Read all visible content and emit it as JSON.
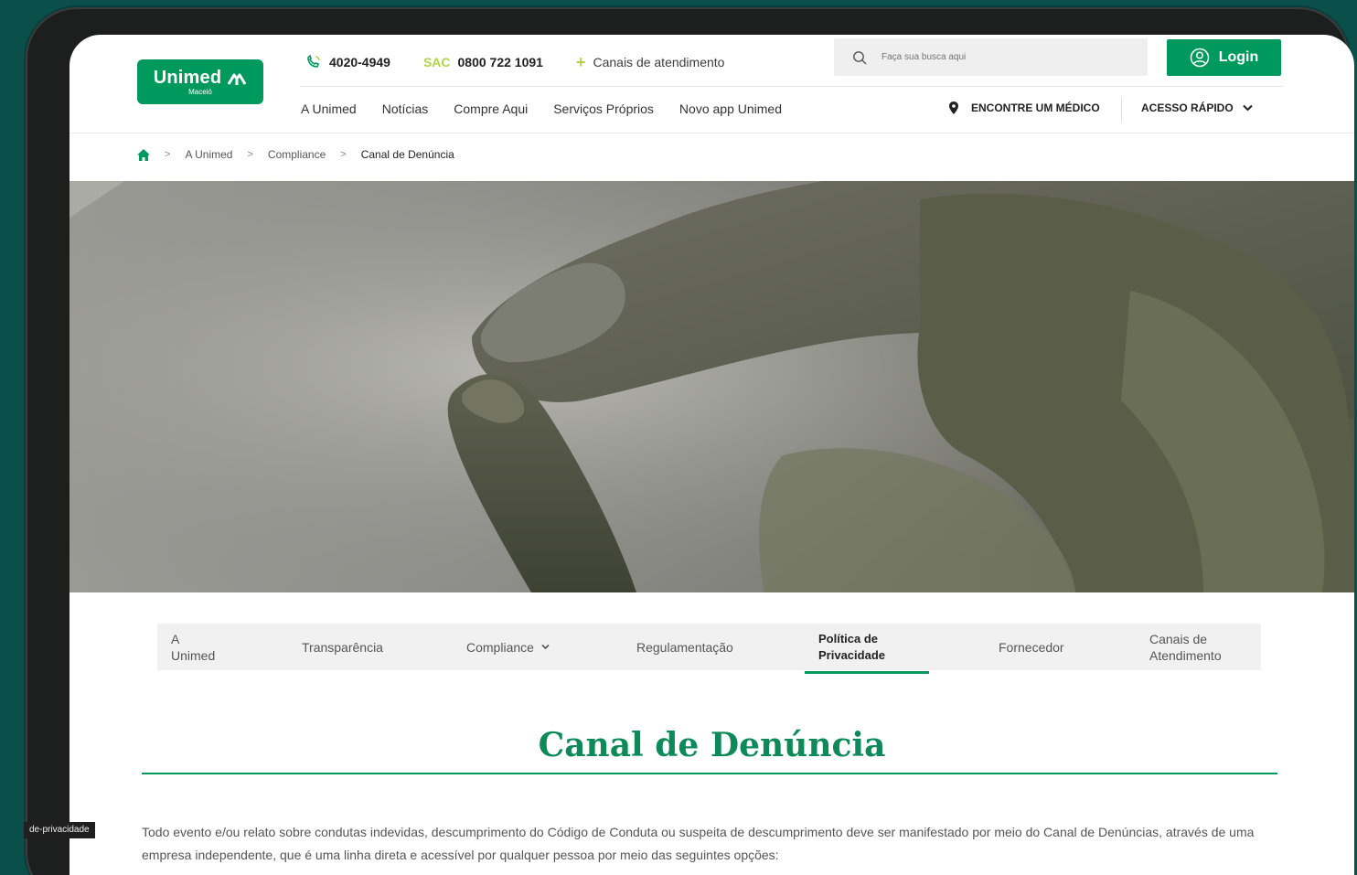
{
  "header": {
    "logo": {
      "name": "Unimed",
      "sub": "Maceió"
    },
    "phone": "4020-4949",
    "sac_label": "SAC",
    "sac_number": "0800 722 1091",
    "canais": "Canais de atendimento",
    "search_placeholder": "Faça sua busca aqui",
    "login_label": "Login",
    "nav": [
      "A Unimed",
      "Notícias",
      "Compre Aqui",
      "Serviços Próprios",
      "Novo app Unimed"
    ],
    "encontre": "ENCONTRE UM MÉDICO",
    "acesso": "ACESSO RÁPIDO"
  },
  "breadcrumb": {
    "items": [
      "A Unimed",
      "Compliance",
      "Canal de Denúncia"
    ]
  },
  "subtabs": {
    "items": [
      {
        "l1": "A",
        "l2": "Unimed"
      },
      {
        "label": "Transparência"
      },
      {
        "label": "Compliance"
      },
      {
        "label": "Regulamentação"
      },
      {
        "l1": "Política de",
        "l2": "Privacidade"
      },
      {
        "label": "Fornecedor"
      },
      {
        "l1": "Canais de",
        "l2": "Atendimento"
      }
    ],
    "active_index": 4
  },
  "content": {
    "title": "Canal de Denúncia",
    "paragraph": "Todo evento e/ou relato sobre condutas indevidas, descumprimento do Código de Conduta ou suspeita de descumprimento deve ser manifestado por meio do Canal de Denúncias, através de uma empresa independente, que é uma linha direta e acessível por qualquer pessoa por meio das seguintes opções:"
  },
  "status_tip": "de-privacidade",
  "colors": {
    "brand": "#00995d",
    "accent": "#b1d34b",
    "background": "#0b4f4a"
  }
}
